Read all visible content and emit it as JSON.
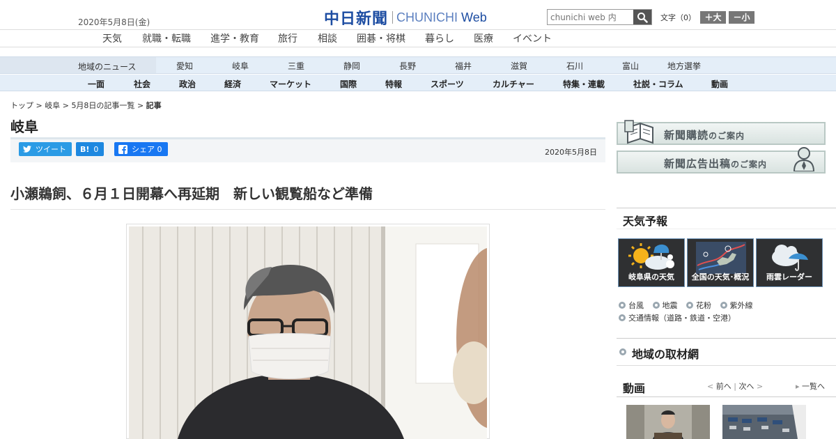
{
  "header": {
    "date": "2020年5月8日(金)",
    "logo_jp": "中日新聞",
    "logo_en_a": "CHUNICHI",
    "logo_en_b": "Web",
    "search_placeholder": "chunichi web 内",
    "font_size_label": "文字（0）",
    "font_larger": "＋大",
    "font_smaller": "－小"
  },
  "global_nav": [
    "天気",
    "就職・転職",
    "進学・教育",
    "旅行",
    "相談",
    "囲碁・将棋",
    "暮らし",
    "医療",
    "イベント"
  ],
  "region_nav": {
    "label": "地域のニュース",
    "items": [
      "愛知",
      "岐阜",
      "三重",
      "静岡",
      "長野",
      "福井",
      "滋賀",
      "石川",
      "富山",
      "地方選挙"
    ]
  },
  "category_nav": [
    "一面",
    "社会",
    "政治",
    "経済",
    "マーケット",
    "国際",
    "特報",
    "スポーツ",
    "カルチャー",
    "特集・連載",
    "社説・コラム",
    "動画"
  ],
  "breadcrumb": {
    "items": [
      "トップ",
      "岐阜",
      "5月8日の記事一覧"
    ],
    "separator": ">",
    "current": "記事"
  },
  "section_title": "岐阜",
  "share": {
    "tweet": "ツイート",
    "hatena_icon": "B!",
    "hatena_count": "0",
    "fb_label": "シェア",
    "fb_count": "0"
  },
  "article": {
    "date": "2020年5月8日",
    "headline": "小瀬鵜飼、６月１日開幕へ再延期　新しい観覧船など準備"
  },
  "sidebar": {
    "banner_subscribe": "新聞購読",
    "banner_subscribe_suffix": "のご案内",
    "banner_ad": "新聞広告出稿",
    "banner_ad_suffix": "のご案内",
    "weather_title": "天気予報",
    "weather_boxes": [
      "岐阜県の天気",
      "全国の天気･概況",
      "雨雲レーダー"
    ],
    "weather_links_row1": [
      "台風",
      "地震",
      "花粉",
      "紫外線"
    ],
    "weather_links_row2": [
      "交通情報（道路・鉄道・空港）"
    ],
    "region_network": "地域の取材網",
    "video_title": "動画",
    "video_prev": "前へ",
    "video_next": "次へ",
    "video_all": "一覧へ"
  },
  "colors": {
    "brand_blue": "#1d4da2",
    "nav_bg": "#e4eef8",
    "twitter": "#2b9be5",
    "hatena": "#1e88e0",
    "facebook": "#1877f2"
  }
}
